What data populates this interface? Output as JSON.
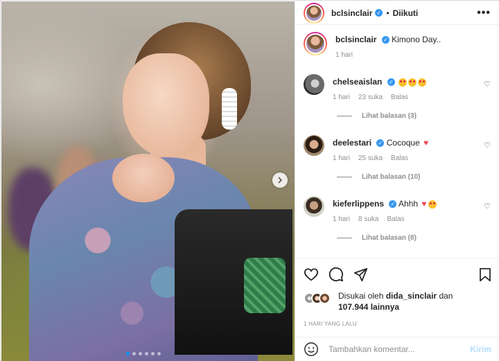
{
  "post": {
    "username": "bclsinclair",
    "separator": "•",
    "follow_status": "Diikuti",
    "more_glyph": "•••",
    "carousel_pages": 6,
    "carousel_active": 0
  },
  "caption": {
    "username": "bclsinclair",
    "text": "Kimono Day..",
    "time": "1 hari"
  },
  "comments": [
    {
      "username": "chelseaislan",
      "text": "",
      "emoji": [
        "star-struck",
        "star-struck",
        "star-struck"
      ],
      "time": "1 hari",
      "likes": "23 suka",
      "reply": "Balas",
      "view_replies": "Lihat balasan (3)"
    },
    {
      "username": "deelestari",
      "text": "Cocoque",
      "emoji": [
        "red-heart"
      ],
      "time": "1 hari",
      "likes": "25 suka",
      "reply": "Balas",
      "view_replies": "Lihat balasan (10)"
    },
    {
      "username": "kieferlippens",
      "text": "Ahhh",
      "emoji": [
        "red-heart",
        "star-struck"
      ],
      "time": "1 hari",
      "likes": "8 suka",
      "reply": "Balas",
      "view_replies": "Lihat balasan (8)"
    }
  ],
  "likes": {
    "prefix": "Disukai oleh",
    "user": "dida_sinclair",
    "conj": "dan",
    "count": "107.944 lainnya"
  },
  "timeago": "1 HARI YANG LALU",
  "add_comment": {
    "placeholder": "Tambahkan komentar...",
    "send_label": "Kirim"
  },
  "colors": {
    "verified": "#3897f0",
    "heart": "#ed4956",
    "send_disabled": "#b2dffc",
    "muted": "#8e8e8e"
  }
}
